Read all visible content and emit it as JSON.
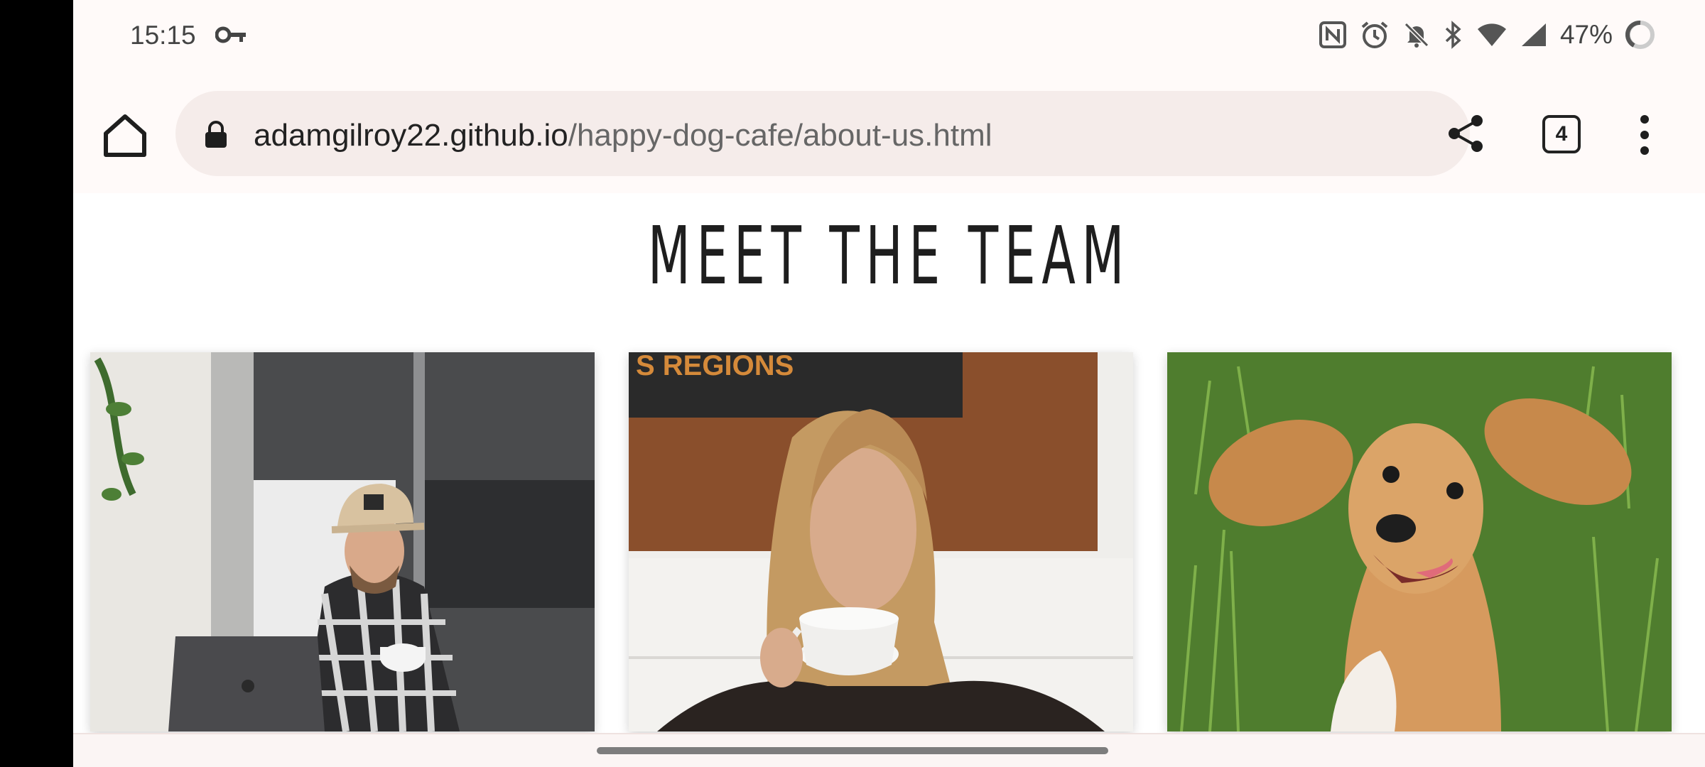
{
  "status_bar": {
    "time": "15:15",
    "battery": "47%",
    "icons": [
      "key-icon",
      "nfc-icon",
      "alarm-icon",
      "bell-off-icon",
      "bluetooth-icon",
      "wifi-icon",
      "signal-icon",
      "battery-icon"
    ]
  },
  "toolbar": {
    "url_domain": "adamgilroy22.github.io",
    "url_path": "/happy-dog-cafe/about-us.html",
    "tab_count": "4"
  },
  "page": {
    "title": "MEET THE TEAM",
    "team_cards": [
      {
        "image": "man in cap with laptop and coffee cup"
      },
      {
        "image": "woman drinking from white coffee cup"
      },
      {
        "image": "golden dog lying on grass"
      }
    ],
    "sign_text": "S REGIONS"
  },
  "colors": {
    "background": "#fffaf9",
    "urlbar": "#f5ecea",
    "title": "#1e1e1e"
  }
}
